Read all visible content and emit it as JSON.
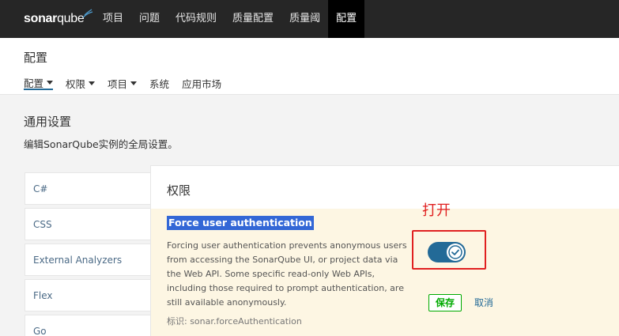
{
  "brand": {
    "name_part1": "sonar",
    "name_part2": "qube"
  },
  "nav": {
    "items": [
      {
        "label": "项目"
      },
      {
        "label": "问题"
      },
      {
        "label": "代码规则"
      },
      {
        "label": "质量配置"
      },
      {
        "label": "质量阈"
      },
      {
        "label": "配置"
      }
    ],
    "active_index": 5
  },
  "page": {
    "title": "配置",
    "subnav": [
      {
        "label": "配置"
      },
      {
        "label": "权限"
      },
      {
        "label": "项目"
      },
      {
        "label": "系统"
      },
      {
        "label": "应用市场"
      }
    ]
  },
  "section": {
    "title": "通用设置",
    "description": "编辑SonarQube实例的全局设置。"
  },
  "categories": [
    {
      "label": "C#"
    },
    {
      "label": "CSS"
    },
    {
      "label": "External Analyzers"
    },
    {
      "label": "Flex"
    },
    {
      "label": "Go"
    }
  ],
  "panel": {
    "title": "权限",
    "setting": {
      "name": "Force user authentication",
      "description": "Forcing user authentication prevents anonymous users from accessing the SonarQube UI, or project data via the Web API. Some specific read-only Web APIs, including those required to prompt authentication, are still available anonymously.",
      "key": "标识: sonar.forceAuthentication",
      "enabled": true
    },
    "save_label": "保存",
    "cancel_label": "取消"
  },
  "annotation": {
    "text": "打开",
    "color": "#e02020"
  },
  "colors": {
    "topbar": "#262626",
    "accent": "#236a97",
    "save": "#00aa00",
    "highlight": "#3367d6"
  }
}
